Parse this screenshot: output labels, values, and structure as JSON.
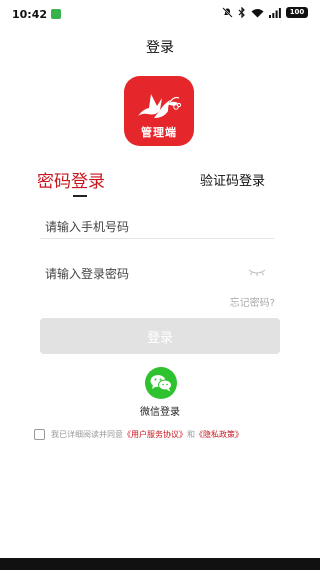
{
  "status_bar": {
    "time": "10:42",
    "battery": "100",
    "notification_color": "#38b24a",
    "icons": [
      "mute-icon",
      "bluetooth-icon",
      "wifi-icon",
      "signal-icon",
      "battery-icon"
    ]
  },
  "header": {
    "title": "登录"
  },
  "logo": {
    "text": "管理端",
    "brand_color": "#e5262a",
    "icon": "dove-logo-icon"
  },
  "tabs": {
    "password": "密码登录",
    "sms": "验证码登录",
    "active": "password",
    "active_color": "#c8161d"
  },
  "form": {
    "phone_placeholder": "请输入手机号码",
    "password_placeholder": "请输入登录密码",
    "forgot": "忘记密码?"
  },
  "login_button": {
    "label": "登录",
    "disabled_color": "#e2e2e2"
  },
  "wechat": {
    "label": "微信登录",
    "color": "#2ec22e",
    "icon": "wechat-icon"
  },
  "agreement": {
    "prefix": "我已详细阅读并同意",
    "user_agreement": "《用户服务协议》",
    "and": "和",
    "privacy": "《隐私政策》",
    "checked": false
  }
}
